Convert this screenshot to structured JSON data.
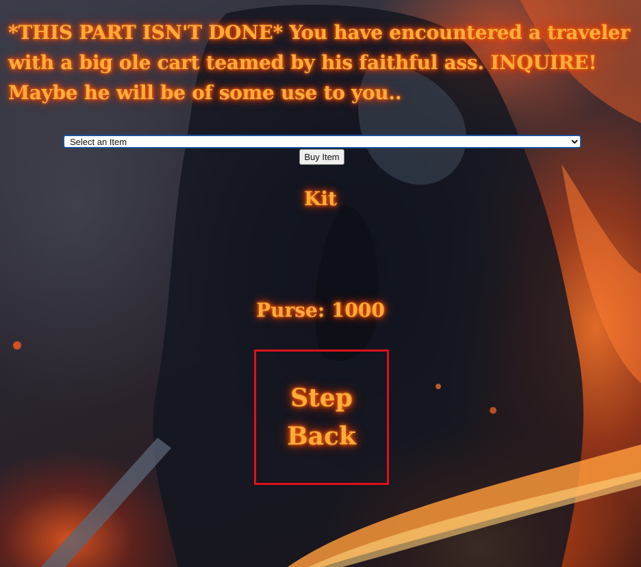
{
  "notice": {
    "text": "*THIS PART ISN'T DONE* You have encountered a traveler with a big ole cart teamed by his faithful ass. INQUIRE! Maybe he will be of some use to you.."
  },
  "shop": {
    "select_value": "Select an Item",
    "buy_label": "Buy Item"
  },
  "inventory": {
    "heading": "Kit"
  },
  "purse": {
    "label": "Purse: 1000"
  },
  "navigation": {
    "step_back_label": "Step Back"
  },
  "colors": {
    "glow_text": "#ffad3d",
    "glow_shadow": "#ff4a00",
    "step_back_border": "#e0101c",
    "select_border": "#1a4f9a"
  }
}
